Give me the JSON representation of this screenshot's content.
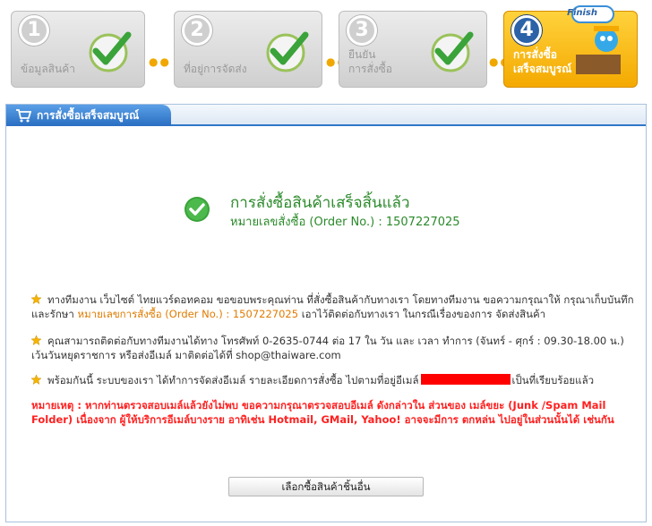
{
  "steps": [
    {
      "number": "1",
      "label": "ข้อมูลสินค้า",
      "active": false
    },
    {
      "number": "2",
      "label": "ที่อยู่การจัดส่ง",
      "active": false
    },
    {
      "number": "3",
      "label": "ยืนยัน\nการสั่งซื้อ",
      "active": false
    },
    {
      "number": "4",
      "label": "การสั่งซื้อ\nเสร็จสมบูรณ์",
      "active": true,
      "badge": "Finish"
    }
  ],
  "tab": {
    "label": "การสั่งซื้อเสร็จสมบูรณ์"
  },
  "success": {
    "title": "การสั่งซื้อสินค้าเสร็จสิ้นแล้ว",
    "order_label": "หมายเลขสั่งซื้อ (Order No.) :",
    "order_no": "1507227025"
  },
  "notes": {
    "n1_a": "ทางทีมงาน เว็บไซต์ ไทยแวร์ดอทคอม ขอขอบพระคุณท่าน ที่สั่งซื้อสินค้ากับทางเรา โดยทางทีมงาน ขอความกรุณาให้ กรุณาเก็บบันทึก และรักษา",
    "n1_hl": "หมายเลขการสั่งซื้อ (Order No.) : 1507227025",
    "n1_b": "เอาไว้ติดต่อกับทางเรา ในกรณีเรื่องของการ จัดส่งสินค้า",
    "n2": "คุณสามารถติดต่อกับทางทีมงานได้ทาง โทรศัพท์ 0-2635-0744 ต่อ 17 ใน วัน และ เวลา ทำการ (จันทร์ - ศุกร์ : 09.30-18.00 น.) เว้นวันหยุดราชการ หรือส่งอีเมล์ มาติดต่อได้ที่ shop@thaiware.com",
    "n3_a": "พร้อมกันนี้ ระบบของเรา ได้ทำการจัดส่งอีเมล์ รายละเอียดการสั่งซื้อ ไปตามที่อยู่อีเมล์",
    "n3_b": "เป็นที่เรียบร้อยแล้ว"
  },
  "warning": "หมายเหตุ : หากท่านตรวจสอบเมล์แล้วยังไม่พบ ขอความกรุณาตรวจสอบอีเมล์ ดังกล่าวใน ส่วนของ เมล์ขยะ (Junk /Spam Mail Folder) เนื่องจาก ผู้ให้บริการอีเมล์บางราย อาทิเช่น Hotmail, GMail, Yahoo! อาจจะมีการ ตกหล่น ไปอยู่ในส่วนนั้นได้ เช่นกัน",
  "button": {
    "label": "เลือกซื้อสินค้าชิ้นอื่น"
  },
  "colors": {
    "accent": "#2f77c8",
    "success": "#2b8a2b",
    "warning": "#ff2020",
    "highlight": "#e07b00",
    "active_step": "#f4a900"
  }
}
